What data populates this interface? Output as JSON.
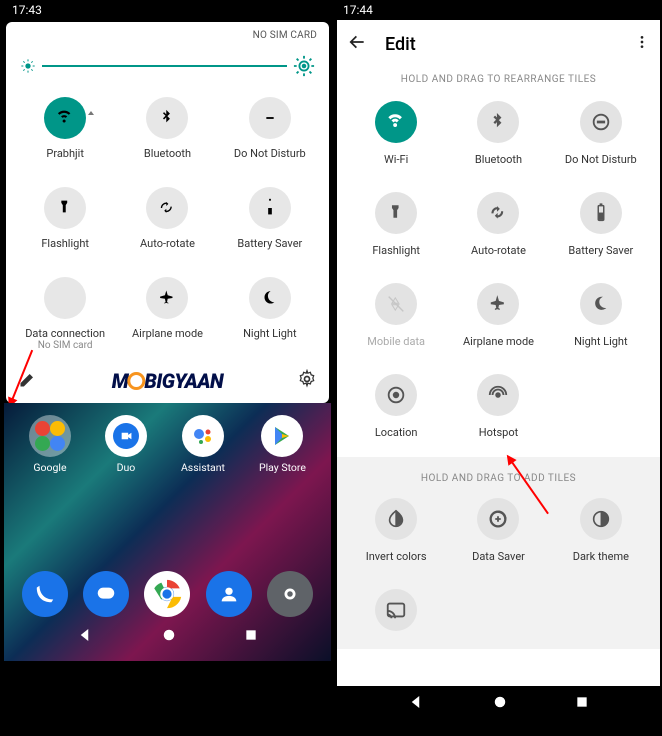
{
  "left": {
    "statusTime": "17:43",
    "qsHeader": "NO SIM CARD",
    "tiles": [
      {
        "label": "Prabhjit",
        "icon": "wifi",
        "on": true,
        "caret": true
      },
      {
        "label": "Bluetooth",
        "icon": "bluetooth",
        "on": false
      },
      {
        "label": "Do Not Disturb",
        "icon": "dnd",
        "on": false
      },
      {
        "label": "Flashlight",
        "icon": "flashlight",
        "on": false
      },
      {
        "label": "Auto-rotate",
        "icon": "rotate",
        "on": false
      },
      {
        "label": "Battery Saver",
        "icon": "battery",
        "on": false
      },
      {
        "label": "Data connection",
        "sub": "No SIM card",
        "icon": "data-off",
        "dim": true
      },
      {
        "label": "Airplane mode",
        "icon": "airplane",
        "on": false
      },
      {
        "label": "Night Light",
        "icon": "night",
        "on": false
      }
    ],
    "watermark": {
      "before": "M",
      "after": "BIGYAAN"
    },
    "apps": [
      {
        "label": "Google",
        "type": "folder"
      },
      {
        "label": "Duo",
        "type": "duo"
      },
      {
        "label": "Assistant",
        "type": "assistant"
      },
      {
        "label": "Play Store",
        "type": "play"
      }
    ]
  },
  "right": {
    "statusTime": "17:44",
    "toolbarTitle": "Edit",
    "hint1": "HOLD AND DRAG TO REARRANGE TILES",
    "tilesActive": [
      {
        "label": "Wi-Fi",
        "icon": "wifi",
        "on": true
      },
      {
        "label": "Bluetooth",
        "icon": "bluetooth"
      },
      {
        "label": "Do Not Disturb",
        "icon": "dnd"
      },
      {
        "label": "Flashlight",
        "icon": "flashlight"
      },
      {
        "label": "Auto-rotate",
        "icon": "rotate"
      },
      {
        "label": "Battery Saver",
        "icon": "battery"
      },
      {
        "label": "Mobile data",
        "icon": "data-off",
        "dim": true
      },
      {
        "label": "Airplane mode",
        "icon": "airplane"
      },
      {
        "label": "Night Light",
        "icon": "night"
      },
      {
        "label": "Location",
        "icon": "location"
      },
      {
        "label": "Hotspot",
        "icon": "hotspot"
      }
    ],
    "hint2": "HOLD AND DRAG TO ADD TILES",
    "tilesInactive": [
      {
        "label": "Invert colors",
        "icon": "invert"
      },
      {
        "label": "Data Saver",
        "icon": "datasaver"
      },
      {
        "label": "Dark theme",
        "icon": "dark"
      },
      {
        "label": "",
        "icon": "cast"
      }
    ]
  }
}
